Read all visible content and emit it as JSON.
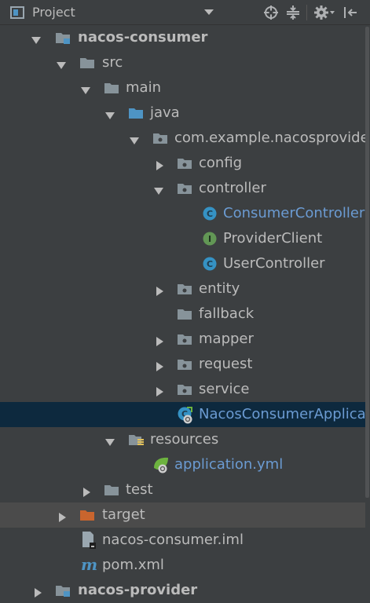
{
  "header": {
    "title": "Project",
    "icons": [
      "project-view-icon",
      "dropdown-arrow-icon",
      "locate-target-icon",
      "collapse-all-icon",
      "gear-icon",
      "hide-panel-icon"
    ]
  },
  "tree": {
    "nacos_consumer": "nacos-consumer",
    "src": "src",
    "main": "main",
    "java": "java",
    "package": "com.example.nacosprovider",
    "config": "config",
    "controller": "controller",
    "consumer_controller": "ConsumerController",
    "provider_client": "ProviderClient",
    "user_controller": "UserController",
    "entity": "entity",
    "fallback": "fallback",
    "mapper": "mapper",
    "request": "request",
    "service": "service",
    "application_class": "NacosConsumerApplicat",
    "resources": "resources",
    "application_yml": "application.yml",
    "test": "test",
    "target": "target",
    "iml": "nacos-consumer.iml",
    "pom": "pom.xml",
    "nacos_provider": "nacos-provider",
    "badge_c": "C",
    "badge_i": "I",
    "pom_glyph": "m"
  },
  "colors": {
    "background": "#3c3f41",
    "selection": "#0d293e",
    "excluded_row": "#4b4b4b",
    "folder_gray": "#87939a",
    "source_folder_blue": "#4e94c4",
    "excluded_folder_orange": "#c9652e",
    "class_badge": "#3592c4",
    "interface_badge": "#629755",
    "link_blue": "#6b9bd2",
    "spring_green": "#6db33f"
  }
}
